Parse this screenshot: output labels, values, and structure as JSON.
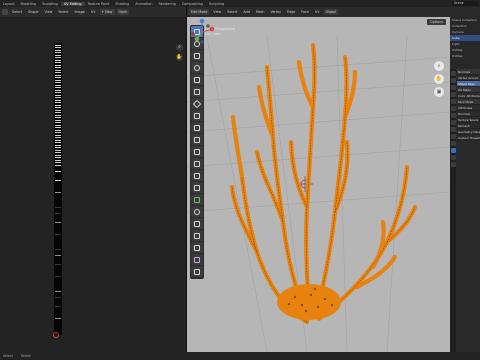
{
  "topbar": {
    "tabs": [
      {
        "label": "Layout"
      },
      {
        "label": "Modeling"
      },
      {
        "label": "Sculpting"
      },
      {
        "label": "UV Editing"
      },
      {
        "label": "Texture Paint"
      },
      {
        "label": "Shading"
      },
      {
        "label": "Animation"
      },
      {
        "label": "Rendering"
      },
      {
        "label": "Compositing"
      },
      {
        "label": "Scripting"
      }
    ],
    "active_tab": "UV Editing",
    "scene": "Scene"
  },
  "uv_editor": {
    "header": {
      "view": "View",
      "select": "Select",
      "image": "Image",
      "uv": "UV",
      "new": "+ New",
      "open": "Open"
    },
    "left_labels": [
      "Select",
      "Shape",
      "UV"
    ]
  },
  "viewport": {
    "header": {
      "mode": "Edit Mode",
      "view": "View",
      "select": "Select",
      "add": "Add",
      "mesh": "Mesh",
      "vertex": "Vertex",
      "edge": "Edge",
      "face": "Face",
      "uv": "UV",
      "orientation": "Global",
      "options": "Options"
    },
    "info_line1": "User Perspective",
    "info_line2": "(0) Cube",
    "object_color": "#e8820f"
  },
  "outliner": {
    "rows": [
      "Scene Collection",
      "Collection",
      "Camera",
      "Cube",
      "Light",
      "UVMap",
      "UVMap"
    ]
  },
  "properties": {
    "sections": [
      "Normals",
      "Vertex Groups",
      "Shape Keys",
      "UV Maps",
      "Color Attributes",
      "Face Maps",
      "Attributes",
      "Normals",
      "Texture Space",
      "Remesh",
      "Geometry Data",
      "Custom Properties"
    ]
  },
  "statusbar": {
    "left": "Select",
    "mid": "Select"
  }
}
